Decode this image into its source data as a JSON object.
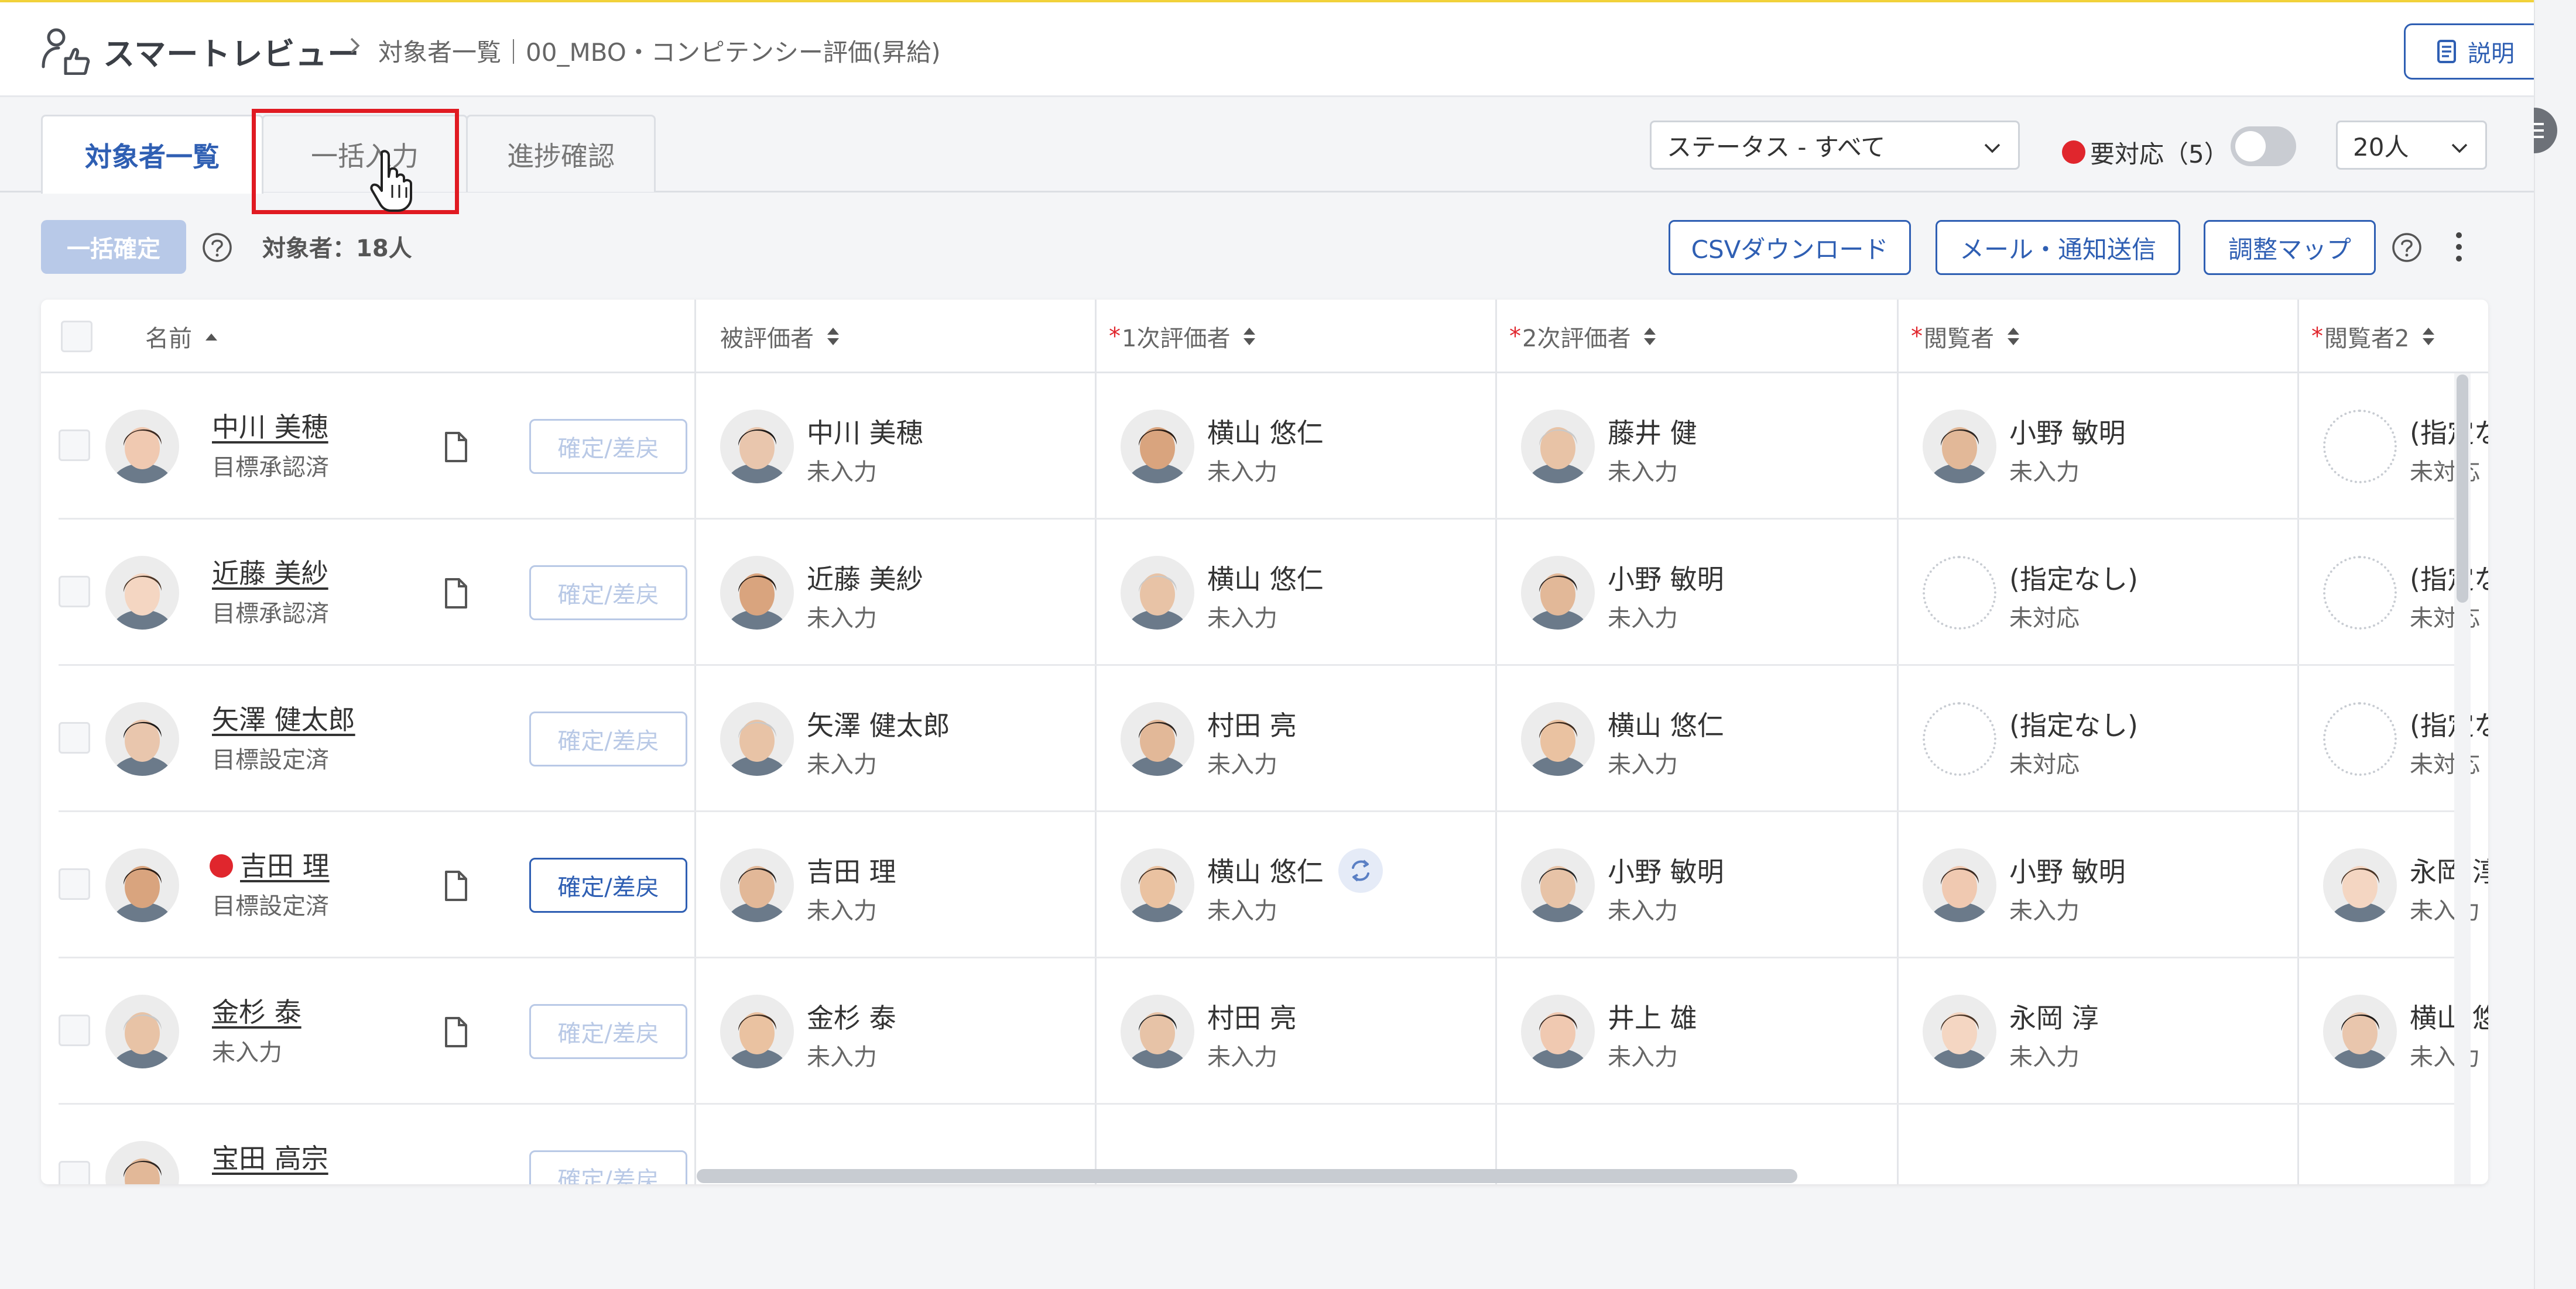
{
  "header": {
    "app_title": "スマートレビュー",
    "breadcrumb": "対象者一覧｜00_MBO・コンピテンシー評価(昇給)",
    "help_label": "説明"
  },
  "tabs": [
    {
      "label": "対象者一覧",
      "active": true
    },
    {
      "label": "一括入力",
      "active": false
    },
    {
      "label": "進捗確認",
      "active": false
    }
  ],
  "filters": {
    "status_select": "ステータス - すべて",
    "needs_action_label": "要対応（5）",
    "page_size": "20人"
  },
  "toolbar": {
    "bulk_confirm": "一括確定",
    "count_label": "対象者：18人",
    "csv_download": "CSVダウンロード",
    "mail_send": "メール・通知送信",
    "adjust_map": "調整マップ"
  },
  "columns": {
    "name": "名前",
    "evaluatee": "被評価者",
    "first_evaluator": "1次評価者",
    "second_evaluator": "2次評価者",
    "viewer": "閲覧者",
    "viewer2": "閲覧者2",
    "required_mark": "*"
  },
  "rows": [
    {
      "name": "中川 美穂",
      "status": "目標承認済",
      "confirm": "確定/差戻",
      "confirm_enabled": false,
      "needs_action": false,
      "evaluatee": {
        "name": "中川 美穂",
        "sub": "未入力"
      },
      "first": {
        "name": "横山 悠仁",
        "sub": "未入力"
      },
      "second": {
        "name": "藤井 健",
        "sub": "未入力"
      },
      "viewer": {
        "name": "小野 敏明",
        "sub": "未入力"
      },
      "viewer2": {
        "name": "(指定なし)",
        "sub": "未対応"
      }
    },
    {
      "name": "近藤 美紗",
      "status": "目標承認済",
      "confirm": "確定/差戻",
      "confirm_enabled": false,
      "needs_action": false,
      "evaluatee": {
        "name": "近藤 美紗",
        "sub": "未入力"
      },
      "first": {
        "name": "横山 悠仁",
        "sub": "未入力"
      },
      "second": {
        "name": "小野 敏明",
        "sub": "未入力"
      },
      "viewer": {
        "name": "(指定なし)",
        "sub": "未対応"
      },
      "viewer2": {
        "name": "(指定なし)",
        "sub": "未対応"
      }
    },
    {
      "name": "矢澤 健太郎",
      "status": "目標設定済",
      "confirm": "確定/差戻",
      "confirm_enabled": false,
      "needs_action": false,
      "evaluatee": {
        "name": "矢澤 健太郎",
        "sub": "未入力"
      },
      "first": {
        "name": "村田 亮",
        "sub": "未入力"
      },
      "second": {
        "name": "横山 悠仁",
        "sub": "未入力"
      },
      "viewer": {
        "name": "(指定なし)",
        "sub": "未対応"
      },
      "viewer2": {
        "name": "(指定なし)",
        "sub": "未対応"
      }
    },
    {
      "name": "吉田 理",
      "status": "目標設定済",
      "confirm": "確定/差戻",
      "confirm_enabled": true,
      "needs_action": true,
      "evaluatee": {
        "name": "吉田 理",
        "sub": "未入力"
      },
      "first": {
        "name": "横山 悠仁",
        "sub": "未入力"
      },
      "second": {
        "name": "小野 敏明",
        "sub": "未入力"
      },
      "viewer": {
        "name": "小野 敏明",
        "sub": "未入力"
      },
      "viewer2": {
        "name": "永岡 淳",
        "sub": "未入力"
      }
    },
    {
      "name": "金杉 泰",
      "status": "未入力",
      "confirm": "確定/差戻",
      "confirm_enabled": false,
      "needs_action": false,
      "evaluatee": {
        "name": "金杉 泰",
        "sub": "未入力"
      },
      "first": {
        "name": "村田 亮",
        "sub": "未入力"
      },
      "second": {
        "name": "井上 雄",
        "sub": "未入力"
      },
      "viewer": {
        "name": "永岡 淳",
        "sub": "未入力"
      },
      "viewer2": {
        "name": "横山 悠仁",
        "sub": "未入力"
      }
    },
    {
      "name": "宝田 高宗",
      "status": "",
      "confirm": "確定/差戻",
      "confirm_enabled": false,
      "needs_action": false,
      "evaluatee": {
        "name": "",
        "sub": ""
      },
      "first": {
        "name": "",
        "sub": ""
      },
      "second": {
        "name": "",
        "sub": ""
      },
      "viewer": {
        "name": "",
        "sub": ""
      },
      "viewer2": {
        "name": "",
        "sub": ""
      }
    }
  ],
  "colors": {
    "accent": "#2f5fb3",
    "alert": "#e0262d",
    "highlight_box": "#e01a22"
  }
}
